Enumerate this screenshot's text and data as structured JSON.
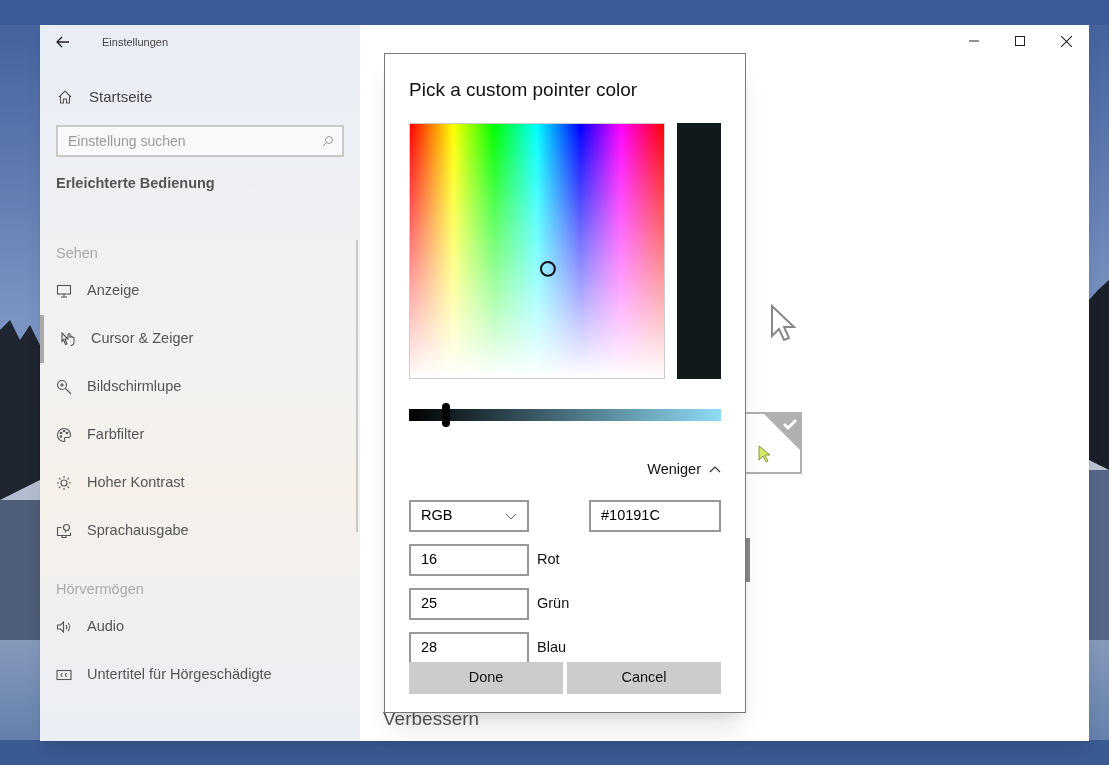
{
  "window": {
    "title": "Einstellungen"
  },
  "sidebar": {
    "home": {
      "label": "Startseite"
    },
    "search": {
      "placeholder": "Einstellung suchen"
    },
    "section_title": "Erleichterte Bedienung",
    "groups": [
      {
        "heading": "Sehen",
        "items": [
          {
            "label": "Anzeige",
            "kind": "display",
            "selected": false
          },
          {
            "label": "Cursor & Zeiger",
            "kind": "cursor",
            "selected": true
          },
          {
            "label": "Bildschirmlupe",
            "kind": "magnifier",
            "selected": false
          },
          {
            "label": "Farbfilter",
            "kind": "palette",
            "selected": false
          },
          {
            "label": "Hoher Kontrast",
            "kind": "contrast",
            "selected": false
          },
          {
            "label": "Sprachausgabe",
            "kind": "narrator",
            "selected": false
          }
        ]
      },
      {
        "heading": "Hörvermögen",
        "items": [
          {
            "label": "Audio",
            "kind": "audio",
            "selected": false
          },
          {
            "label": "Untertitel für Hörgeschädigte",
            "kind": "captions",
            "selected": false
          }
        ]
      }
    ]
  },
  "content": {
    "partial_heading": "Verbessern",
    "pointer_tile": {
      "selected": true
    }
  },
  "dialog": {
    "title": "Pick a custom pointer color",
    "slider": {
      "level": 0.12
    },
    "toggle": {
      "label": "Weniger",
      "expanded": true
    },
    "mode": {
      "value": "RGB"
    },
    "hex": {
      "value": "#10191C"
    },
    "channels": [
      {
        "value": "16",
        "label": "Rot"
      },
      {
        "value": "25",
        "label": "Grün"
      },
      {
        "value": "28",
        "label": "Blau"
      }
    ],
    "buttons": [
      "Done",
      "Cancel"
    ]
  }
}
